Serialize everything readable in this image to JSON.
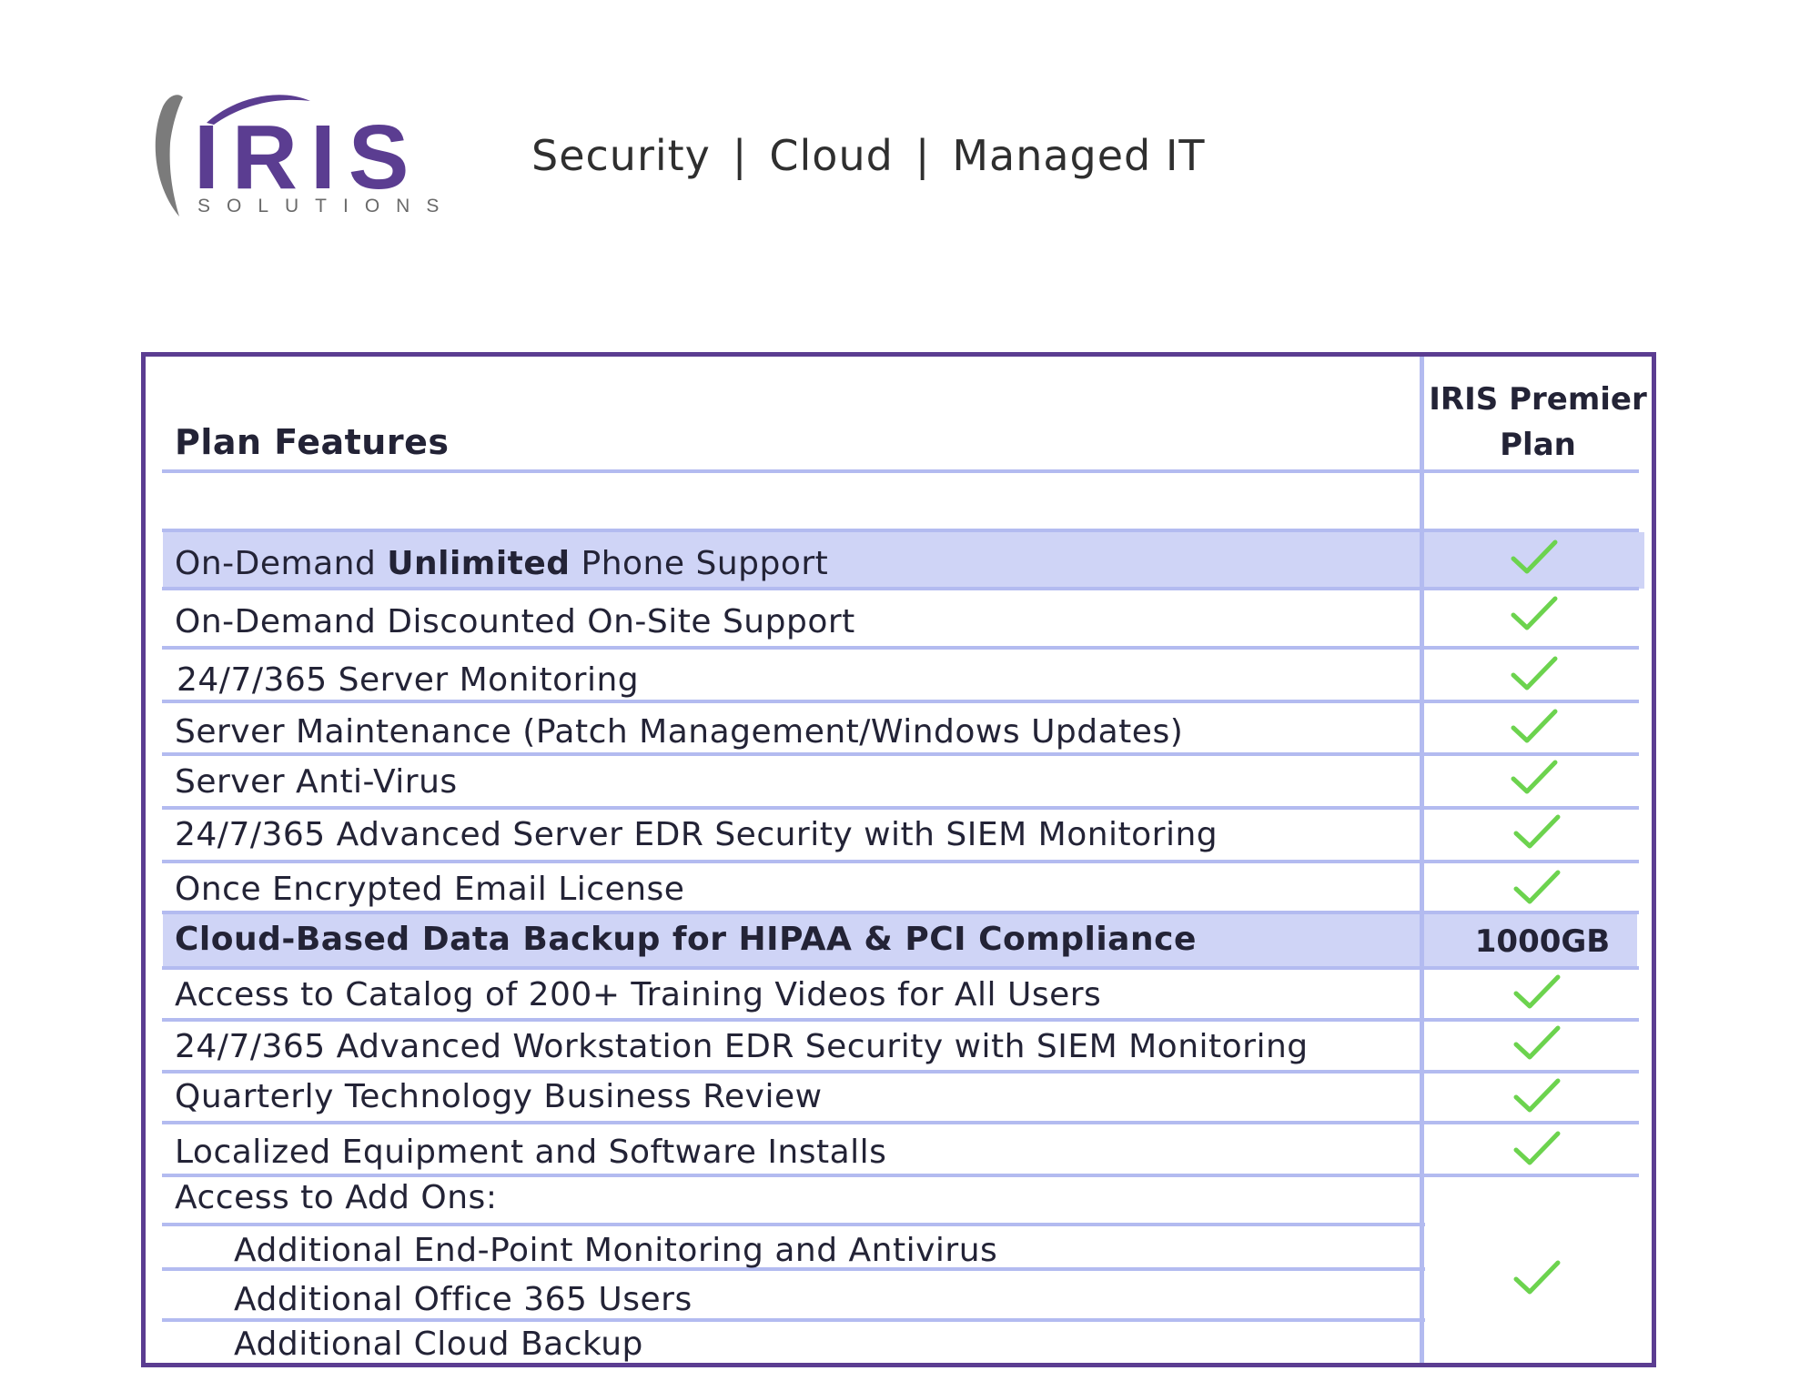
{
  "logo": {
    "wordmark": "IRIS",
    "subtitle": "SOLUTIONS",
    "colors": {
      "purple": "#5b3d91",
      "gray": "#7b7b7b"
    }
  },
  "tagline": {
    "items": [
      "Security",
      "Cloud",
      "Managed IT"
    ],
    "separator": "|"
  },
  "table": {
    "header": {
      "features_label": "Plan Features",
      "plan_line1": "IRIS Premier",
      "plan_line2": "Plan"
    },
    "rows": [
      {
        "pre": "On-Demand ",
        "bold": "Unlimited",
        "post": " Phone Support",
        "mark": "check",
        "highlight": true
      },
      {
        "label": "On-Demand Discounted On-Site Support",
        "mark": "check"
      },
      {
        "label": "24/7/365 Server Monitoring",
        "mark": "check"
      },
      {
        "label": "Server Maintenance (Patch Management/Windows Updates)",
        "mark": "check"
      },
      {
        "label": "Server Anti-Virus",
        "mark": "check"
      },
      {
        "label": "24/7/365 Advanced Server EDR Security with SIEM Monitoring",
        "mark": "check"
      },
      {
        "label": "Once Encrypted Email License",
        "mark": "check"
      },
      {
        "label": "Cloud-Based Data Backup for HIPAA & PCI Compliance",
        "value": "1000GB",
        "highlight": true,
        "bold_row": true
      },
      {
        "label": "Access to Catalog of 200+ Training Videos for All Users",
        "mark": "check"
      },
      {
        "label": "24/7/365 Advanced Workstation EDR Security with SIEM Monitoring",
        "mark": "check"
      },
      {
        "label": "Quarterly Technology Business Review",
        "mark": "check"
      },
      {
        "label": "Localized Equipment and Software Installs",
        "mark": "check"
      },
      {
        "label": "Access to Add Ons:"
      },
      {
        "label": "Additional End-Point Monitoring and Antivirus"
      },
      {
        "label": "Additional Office 365 Users"
      },
      {
        "label": "Additional Cloud Backup"
      }
    ],
    "addons_mark": "check",
    "colors": {
      "border": "#5b3d91",
      "rule": "#b3bbf0",
      "highlight": "#cfd4f6",
      "check": "#6cd34e"
    }
  }
}
